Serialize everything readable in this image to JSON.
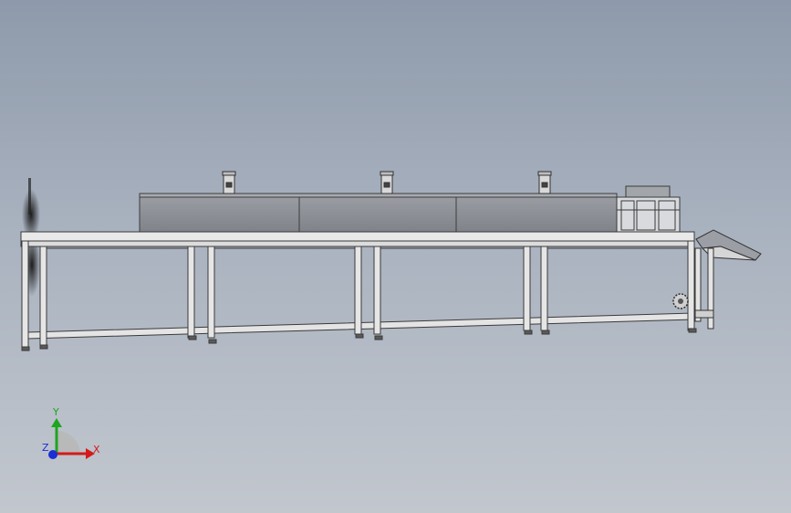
{
  "window": {
    "title": ""
  },
  "triad": {
    "x_label": "X",
    "y_label": "Y",
    "z_label": "Z",
    "x_color": "#d41a1a",
    "y_color": "#1fa51f",
    "z_color": "#1a2fd4"
  },
  "model": {
    "frame_color": "#e6e6e6",
    "frame_edge": "#3a3a3a",
    "housing_color": "#8a8d93",
    "icons": [
      "coordinate-triad-icon",
      "gear-sprocket-icon"
    ]
  }
}
